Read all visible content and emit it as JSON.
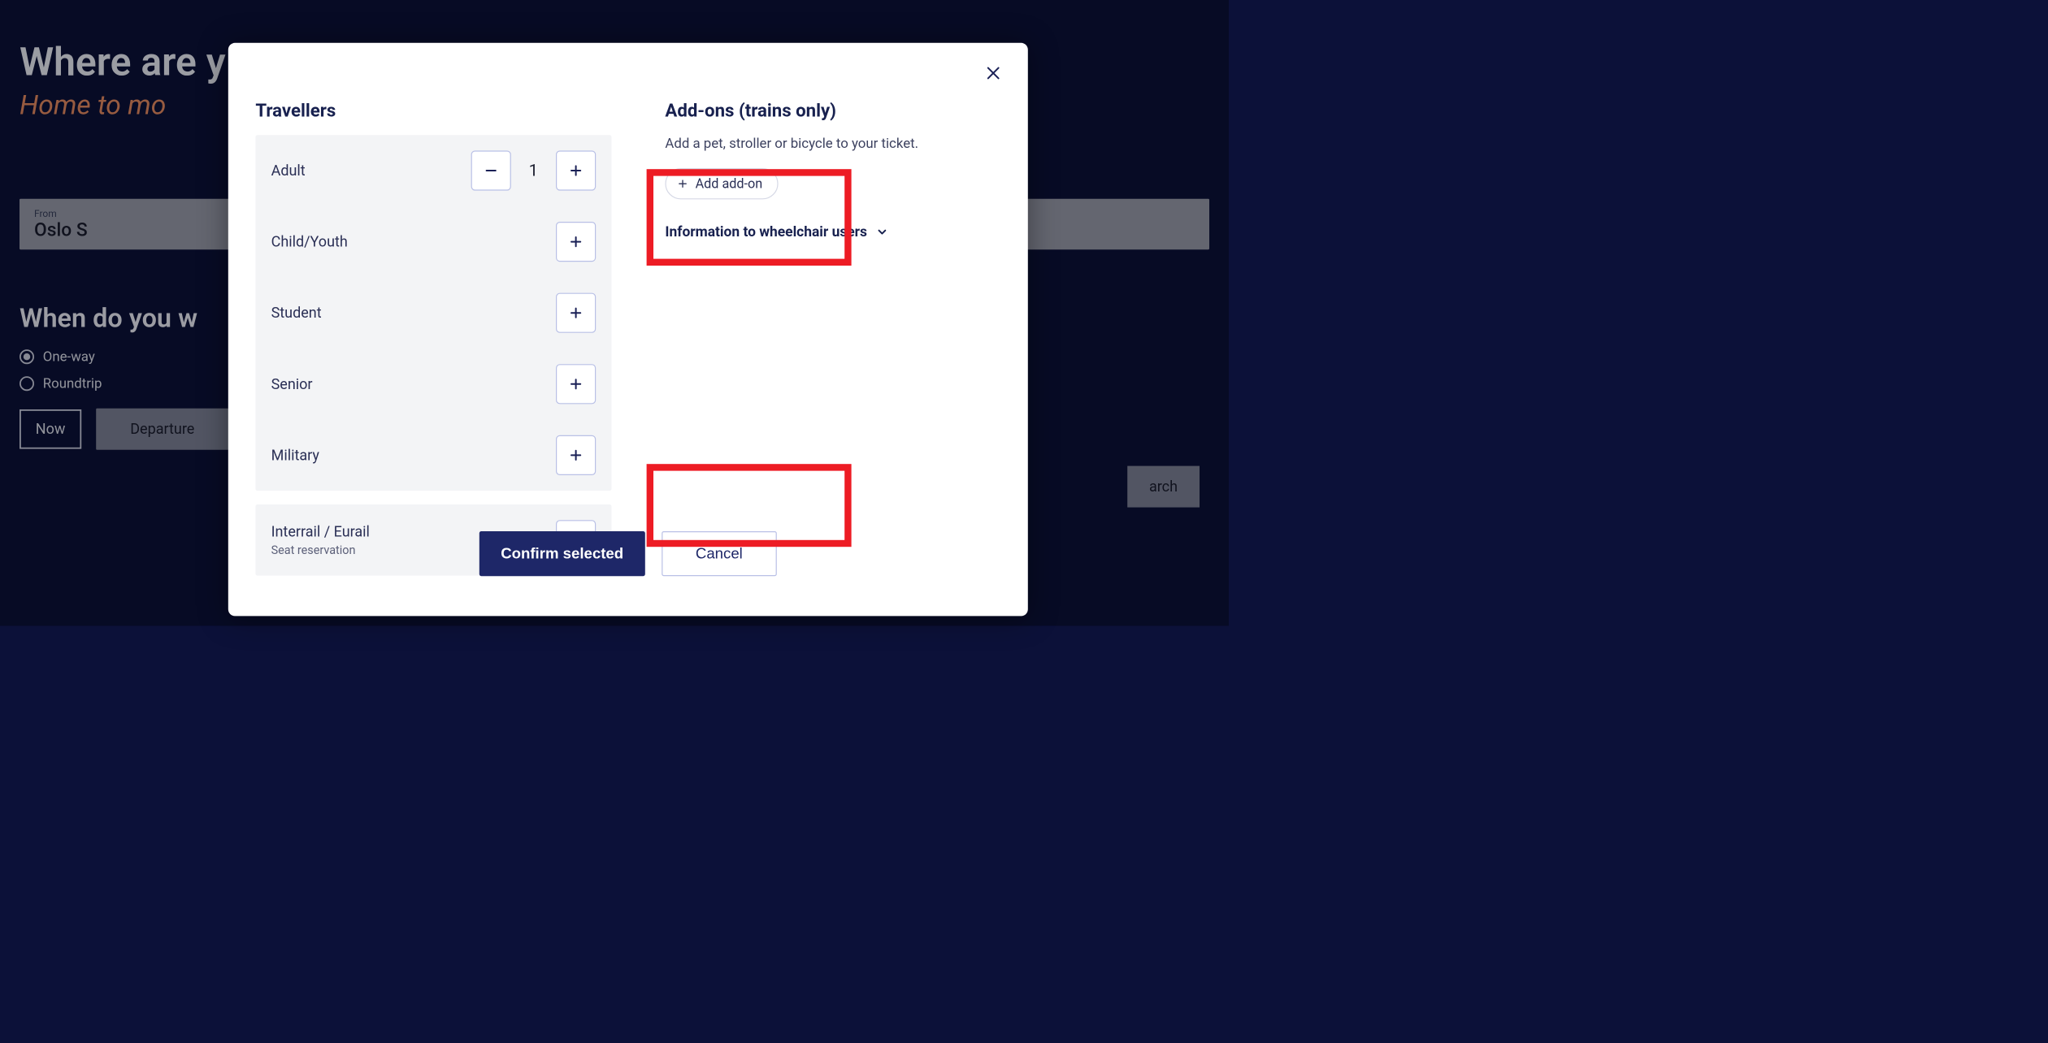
{
  "hero": {
    "title_partial": "Where are y",
    "subtitle_partial": "Home to mo"
  },
  "search": {
    "from_label": "From",
    "from_value": "Oslo S"
  },
  "when": {
    "heading": "When do you w",
    "one_way": "One-way",
    "roundtrip": "Roundtrip",
    "now": "Now",
    "departure": "Departure",
    "search_btn": "arch"
  },
  "modal": {
    "travellers_heading": "Travellers",
    "rows": [
      {
        "label": "Adult",
        "sub": "",
        "count": "1",
        "show_minus": true
      },
      {
        "label": "Child/Youth",
        "sub": "",
        "count": "",
        "show_minus": false
      },
      {
        "label": "Student",
        "sub": "",
        "count": "",
        "show_minus": false
      },
      {
        "label": "Senior",
        "sub": "",
        "count": "",
        "show_minus": false
      },
      {
        "label": "Military",
        "sub": "",
        "count": "",
        "show_minus": false
      }
    ],
    "interrail": {
      "label": "Interrail / Eurail",
      "sub": "Seat reservation"
    },
    "addons": {
      "heading": "Add-ons (trains only)",
      "desc": "Add a pet, stroller or bicycle to your ticket.",
      "pill": "Add add-on",
      "info": "Information to wheelchair users"
    },
    "confirm": "Confirm selected",
    "cancel": "Cancel"
  }
}
